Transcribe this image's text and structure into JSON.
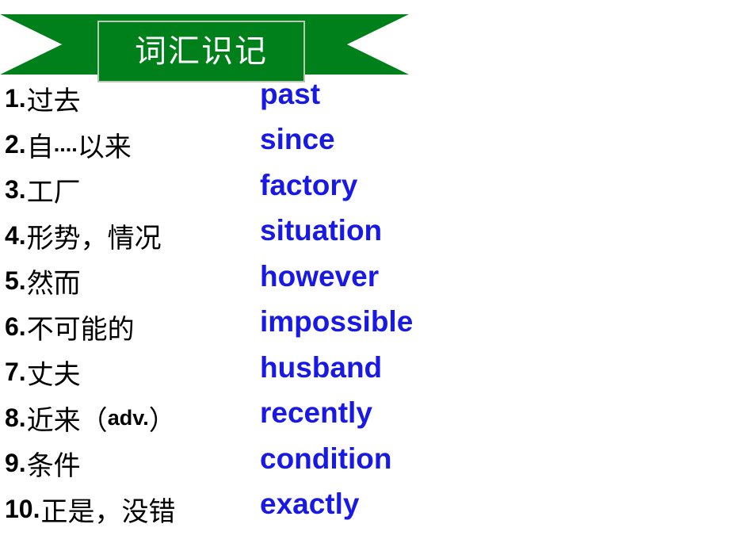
{
  "banner": {
    "title": "词汇识记",
    "color": "#00801b"
  },
  "colors": {
    "english": "#1919e6",
    "chinese": "#000000",
    "banner": "#00801b"
  },
  "vocabulary": [
    {
      "num": "1.",
      "chinese": "过去",
      "tag": "",
      "tag_suffix": "",
      "english": "past"
    },
    {
      "num": "2.",
      "chinese": "自",
      "tag": "....",
      "tag_suffix": "以来",
      "english": "since"
    },
    {
      "num": "3.",
      "chinese": "工厂",
      "tag": "",
      "tag_suffix": "",
      "english": "factory"
    },
    {
      "num": "4.",
      "chinese": "形势，情况",
      "tag": "",
      "tag_suffix": "",
      "english": "situation"
    },
    {
      "num": "5.",
      "chinese": "然而",
      "tag": "",
      "tag_suffix": "",
      "english": "however"
    },
    {
      "num": "6.",
      "chinese": "不可能的",
      "tag": "",
      "tag_suffix": "",
      "english": "impossible"
    },
    {
      "num": "7.",
      "chinese": "丈夫",
      "tag": "",
      "tag_suffix": "",
      "english": "husband"
    },
    {
      "num": "8.",
      "chinese": "近来（",
      "tag": "adv.",
      "tag_suffix": "）",
      "english": "recently"
    },
    {
      "num": "9.",
      "chinese": "条件",
      "tag": "",
      "tag_suffix": "",
      "english": "condition"
    },
    {
      "num": "10.",
      "chinese": "正是，没错",
      "tag": "",
      "tag_suffix": "",
      "english": "exactly"
    }
  ]
}
